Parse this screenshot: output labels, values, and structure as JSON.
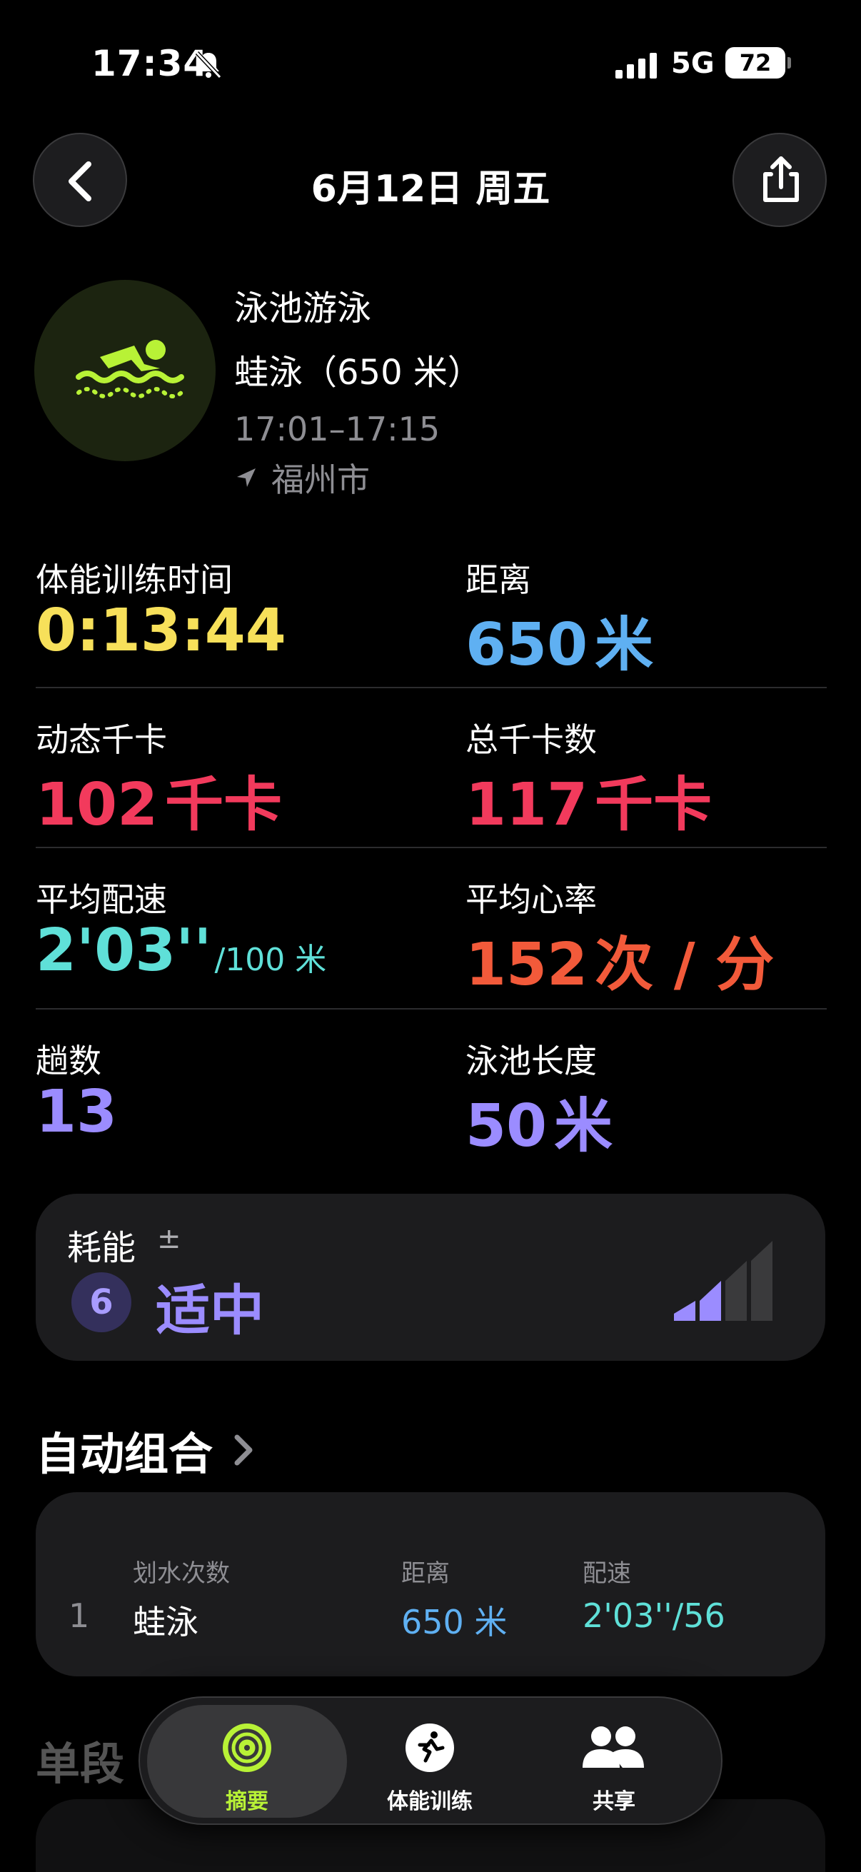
{
  "status": {
    "time": "17:34",
    "network": "5G",
    "battery": "72"
  },
  "nav": {
    "title": "6月12日 周五"
  },
  "workout": {
    "type": "泳池游泳",
    "subtitle": "蛙泳（650 米）",
    "time_range": "17:01–17:15",
    "location": "福州市"
  },
  "metrics": {
    "duration": {
      "label": "体能训练时间",
      "value": "0:13:44",
      "color": "#f7e05a"
    },
    "distance": {
      "label": "距离",
      "value": "650",
      "unit": "米",
      "color": "#5fb0f2"
    },
    "active_cal": {
      "label": "动态千卡",
      "value": "102",
      "unit": "千卡",
      "color": "#f23a5c"
    },
    "total_cal": {
      "label": "总千卡数",
      "value": "117",
      "unit": "千卡",
      "color": "#f23a5c"
    },
    "pace": {
      "label": "平均配速",
      "value": "2'03''",
      "unit": "/100 米",
      "color": "#5fe0d8"
    },
    "heart_rate": {
      "label": "平均心率",
      "value": "152",
      "unit": "次 / 分",
      "color": "#f25a3a"
    },
    "laps": {
      "label": "趟数",
      "value": "13",
      "color": "#9b8cff"
    },
    "pool_length": {
      "label": "泳池长度",
      "value": "50",
      "unit": "米",
      "color": "#9b8cff"
    }
  },
  "effort": {
    "label": "耗能",
    "adjust_symbol": "±",
    "score": "6",
    "level_text": "适中",
    "level_fraction": 0.5,
    "color": "#9b8cff"
  },
  "auto_sets": {
    "title": "自动组合",
    "headers": {
      "stroke": "划水次数",
      "distance": "距离",
      "pace": "配速"
    },
    "rows": [
      {
        "index": "1",
        "stroke": "蛙泳",
        "distance": "650 米",
        "pace": "2'03''/56"
      }
    ]
  },
  "splits_title": "单段",
  "tabs": [
    {
      "label": "摘要",
      "icon": "activity-rings-icon",
      "active": true
    },
    {
      "label": "体能训练",
      "icon": "running-figure-icon",
      "active": false
    },
    {
      "label": "共享",
      "icon": "people-icon",
      "active": false
    }
  ],
  "colors": {
    "accent_green": "#b8f236",
    "background": "#000000",
    "card": "#1c1c1e"
  }
}
